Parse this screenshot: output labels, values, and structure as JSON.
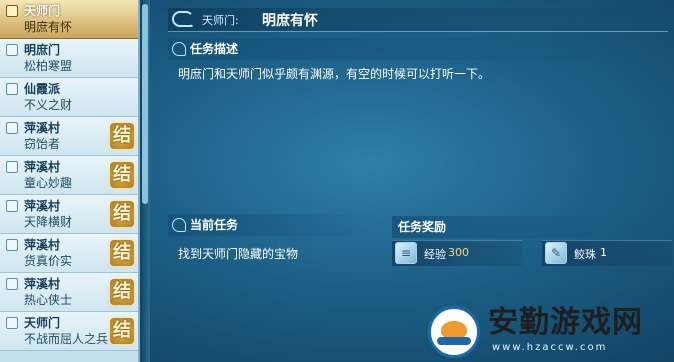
{
  "quest_list": {
    "items": [
      {
        "location": "天师门",
        "name": "明庶有怀",
        "state": "",
        "active": true
      },
      {
        "location": "明庶门",
        "name": "松柏寒盟",
        "state": "",
        "active": false
      },
      {
        "location": "仙霞派",
        "name": "不义之财",
        "state": "",
        "active": false
      },
      {
        "location": "萍溪村",
        "name": "窃饴者",
        "state": "结",
        "active": false
      },
      {
        "location": "萍溪村",
        "name": "童心妙趣",
        "state": "结",
        "active": false
      },
      {
        "location": "萍溪村",
        "name": "天降横财",
        "state": "结",
        "active": false
      },
      {
        "location": "萍溪村",
        "name": "货真价实",
        "state": "结",
        "active": false
      },
      {
        "location": "萍溪村",
        "name": "热心侠士",
        "state": "结",
        "active": false
      },
      {
        "location": "天师门",
        "name": "不战而屈人之兵",
        "state": "结",
        "active": false
      }
    ]
  },
  "header": {
    "location": "天师门:",
    "quest_name": "明庶有怀"
  },
  "description": {
    "title": "任务描述",
    "text": "明庶门和天师门似乎颇有渊源，有空的时候可以打听一下。"
  },
  "current_task": {
    "title": "当前任务",
    "text": "找到天师门隐藏的宝物"
  },
  "rewards": {
    "title": "任务奖励",
    "items": [
      {
        "label": "经验",
        "value": "300",
        "icon": "scroll-icon"
      },
      {
        "label": "鲛珠",
        "value": "1",
        "icon": "feather-icon"
      }
    ]
  },
  "watermark": {
    "text": "安勤游戏网",
    "url": "www.hzaccw.com"
  }
}
